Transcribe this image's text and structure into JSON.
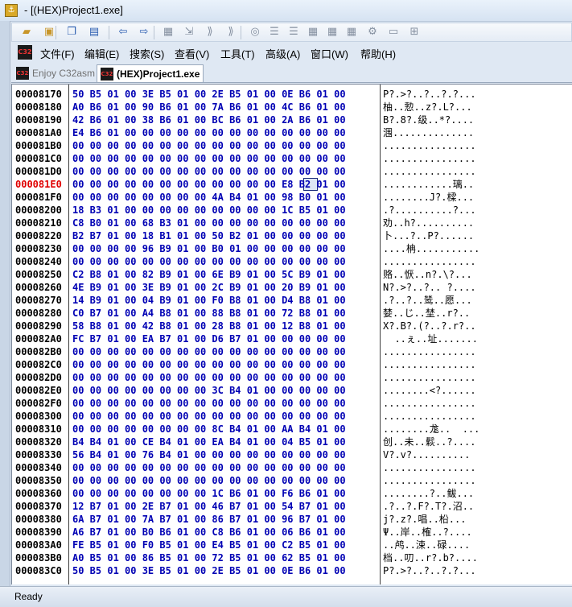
{
  "window": {
    "title": "- [(HEX)Project1.exe]"
  },
  "toolbar": {
    "buttons": [
      {
        "name": "open-folder-icon",
        "glyph": "▰"
      },
      {
        "name": "save-icon",
        "glyph": "▣"
      },
      {
        "name": "copy-icon",
        "glyph": "❐"
      },
      {
        "name": "paste-icon",
        "glyph": "▤"
      },
      {
        "name": "back-arrow-icon",
        "glyph": "⇦"
      },
      {
        "name": "forward-arrow-icon",
        "glyph": "⇨"
      },
      {
        "name": "tool-a-icon",
        "glyph": "▦"
      },
      {
        "name": "tool-b-icon",
        "glyph": "⇲"
      },
      {
        "name": "tool-c-icon",
        "glyph": "⟫"
      },
      {
        "name": "tool-d-icon",
        "glyph": "⟫"
      },
      {
        "name": "tool-e-icon",
        "glyph": "◎"
      },
      {
        "name": "tool-f-icon",
        "glyph": "☰"
      },
      {
        "name": "tool-g-icon",
        "glyph": "☰"
      },
      {
        "name": "tool-h-icon",
        "glyph": "▦"
      },
      {
        "name": "tool-i-icon",
        "glyph": "▦"
      },
      {
        "name": "tool-j-icon",
        "glyph": "▦"
      },
      {
        "name": "tool-k-icon",
        "glyph": "⚙"
      },
      {
        "name": "tool-l-icon",
        "glyph": "▭"
      },
      {
        "name": "tool-m-icon",
        "glyph": "⊞"
      }
    ]
  },
  "menu": {
    "items": [
      "文件(F)",
      "编辑(E)",
      "搜索(S)",
      "查看(V)",
      "工具(T)",
      "高级(A)",
      "窗口(W)",
      "帮助(H)"
    ]
  },
  "tabs": {
    "items": [
      {
        "label": "Enjoy C32asm",
        "active": false
      },
      {
        "label": "(HEX)Project1.exe",
        "active": true
      }
    ],
    "logo_text": "C32"
  },
  "hex": {
    "highlight_address": "000081E0",
    "cursor_byte": "E8",
    "rows": [
      {
        "addr": "00008170",
        "bytes": "50 B5 01 00 3E B5 01 00 2E B5 01 00 0E B6 01 00",
        "ascii": "P?.>?..?..?.?..."
      },
      {
        "addr": "00008180",
        "bytes": "A0 B6 01 00 90 B6 01 00 7A B6 01 00 4C B6 01 00",
        "ascii": "柚..愂..z?.L?..."
      },
      {
        "addr": "00008190",
        "bytes": "42 B6 01 00 38 B6 01 00 BC B6 01 00 2A B6 01 00",
        "ascii": "B?.8?.级..*?...."
      },
      {
        "addr": "000081A0",
        "bytes": "E4 B6 01 00 00 00 00 00 00 00 00 00 00 00 00 00",
        "ascii": "涠.............."
      },
      {
        "addr": "000081B0",
        "bytes": "00 00 00 00 00 00 00 00 00 00 00 00 00 00 00 00",
        "ascii": "................"
      },
      {
        "addr": "000081C0",
        "bytes": "00 00 00 00 00 00 00 00 00 00 00 00 00 00 00 00",
        "ascii": "................"
      },
      {
        "addr": "000081D0",
        "bytes": "00 00 00 00 00 00 00 00 00 00 00 00 00 00 00 00",
        "ascii": "................"
      },
      {
        "addr": "000081E0",
        "bytes": "00 00 00 00 00 00 00 00 00 00 00 00 E8 B2 01 00",
        "ascii": "............璃.."
      },
      {
        "addr": "000081F0",
        "bytes": "00 00 00 00 00 00 00 00 4A B4 01 00 98 B0 01 00",
        "ascii": "........J?.樑..."
      },
      {
        "addr": "00008200",
        "bytes": "18 B3 01 00 00 00 00 00 00 00 00 00 1C B5 01 00",
        "ascii": ".?..........?..."
      },
      {
        "addr": "00008210",
        "bytes": "C8 B0 01 00 68 B3 01 00 00 00 00 00 00 00 00 00",
        "ascii": "劝..h?.........."
      },
      {
        "addr": "00008220",
        "bytes": "B2 B7 01 00 18 B1 01 00 50 B2 01 00 00 00 00 00",
        "ascii": "卜...?..P?......"
      },
      {
        "addr": "00008230",
        "bytes": "00 00 00 00 96 B9 01 00 B0 01 00 00 00 00 00 00",
        "ascii": "....柟..........."
      },
      {
        "addr": "00008240",
        "bytes": "00 00 00 00 00 00 00 00 00 00 00 00 00 00 00 00",
        "ascii": "................"
      },
      {
        "addr": "00008250",
        "bytes": "C2 B8 01 00 82 B9 01 00 6E B9 01 00 5C B9 01 00",
        "ascii": "赂..恹..n?.\\?..."
      },
      {
        "addr": "00008260",
        "bytes": "4E B9 01 00 3E B9 01 00 2C B9 01 00 20 B9 01 00",
        "ascii": "N?.>?..?.. ?...."
      },
      {
        "addr": "00008270",
        "bytes": "14 B9 01 00 04 B9 01 00 F0 B8 01 00 D4 B8 01 00",
        "ascii": ".?..?..鸶..愿..."
      },
      {
        "addr": "00008280",
        "bytes": "C0 B7 01 00 A4 B8 01 00 88 B8 01 00 72 B8 01 00",
        "ascii": "婪..じ..埜..r?.."
      },
      {
        "addr": "00008290",
        "bytes": "58 B8 01 00 42 B8 01 00 28 B8 01 00 12 B8 01 00",
        "ascii": "X?.B?.(?..?.r?.."
      },
      {
        "addr": "000082A0",
        "bytes": "FC B7 01 00 EA B7 01 00 D6 B7 01 00 00 00 00 00",
        "ascii": "  ..ぇ..址......."
      },
      {
        "addr": "000082B0",
        "bytes": "00 00 00 00 00 00 00 00 00 00 00 00 00 00 00 00",
        "ascii": "................"
      },
      {
        "addr": "000082C0",
        "bytes": "00 00 00 00 00 00 00 00 00 00 00 00 00 00 00 00",
        "ascii": "................"
      },
      {
        "addr": "000082D0",
        "bytes": "00 00 00 00 00 00 00 00 00 00 00 00 00 00 00 00",
        "ascii": "................"
      },
      {
        "addr": "000082E0",
        "bytes": "00 00 00 00 00 00 00 00 3C B4 01 00 00 00 00 00",
        "ascii": "........<?......"
      },
      {
        "addr": "000082F0",
        "bytes": "00 00 00 00 00 00 00 00 00 00 00 00 00 00 00 00",
        "ascii": "................"
      },
      {
        "addr": "00008300",
        "bytes": "00 00 00 00 00 00 00 00 00 00 00 00 00 00 00 00",
        "ascii": "................"
      },
      {
        "addr": "00008310",
        "bytes": "00 00 00 00 00 00 00 00 8C B4 01 00 AA B4 01 00",
        "ascii": "........尨..  ..."
      },
      {
        "addr": "00008320",
        "bytes": "B4 B4 01 00 CE B4 01 00 EA B4 01 00 04 B5 01 00",
        "ascii": "创..未..鬏..?...."
      },
      {
        "addr": "00008330",
        "bytes": "56 B4 01 00 76 B4 01 00 00 00 00 00 00 00 00 00",
        "ascii": "V?.v?.........."
      },
      {
        "addr": "00008340",
        "bytes": "00 00 00 00 00 00 00 00 00 00 00 00 00 00 00 00",
        "ascii": "................"
      },
      {
        "addr": "00008350",
        "bytes": "00 00 00 00 00 00 00 00 00 00 00 00 00 00 00 00",
        "ascii": "................"
      },
      {
        "addr": "00008360",
        "bytes": "00 00 00 00 00 00 00 00 1C B6 01 00 F6 B6 01 00",
        "ascii": "........?..鲅..."
      },
      {
        "addr": "00008370",
        "bytes": "12 B7 01 00 2E B7 01 00 46 B7 01 00 54 B7 01 00",
        "ascii": ".?..?.F?.T?.沼.."
      },
      {
        "addr": "00008380",
        "bytes": "6A B7 01 00 7A B7 01 00 86 B7 01 00 96 B7 01 00",
        "ascii": "j?.z?.唱..柗..."
      },
      {
        "addr": "00008390",
        "bytes": "A6 B7 01 00 B0 B6 01 00 C8 B6 01 00 06 B6 01 00",
        "ascii": "Ψ..岸..榷..?...."
      },
      {
        "addr": "000083A0",
        "bytes": "FE B5 01 00 F0 B5 01 00 E4 B5 01 00 C2 B5 01 00",
        "ascii": "..鸬..涑..碌...."
      },
      {
        "addr": "000083B0",
        "bytes": "A0 B5 01 00 86 B5 01 00 72 B5 01 00 62 B5 01 00",
        "ascii": "档..叨..r?.b?...."
      },
      {
        "addr": "000083C0",
        "bytes": "50 B5 01 00 3E B5 01 00 2E B5 01 00 0E B6 01 00",
        "ascii": "P?.>?..?..?.?..."
      }
    ]
  },
  "status": {
    "text": "Ready"
  }
}
